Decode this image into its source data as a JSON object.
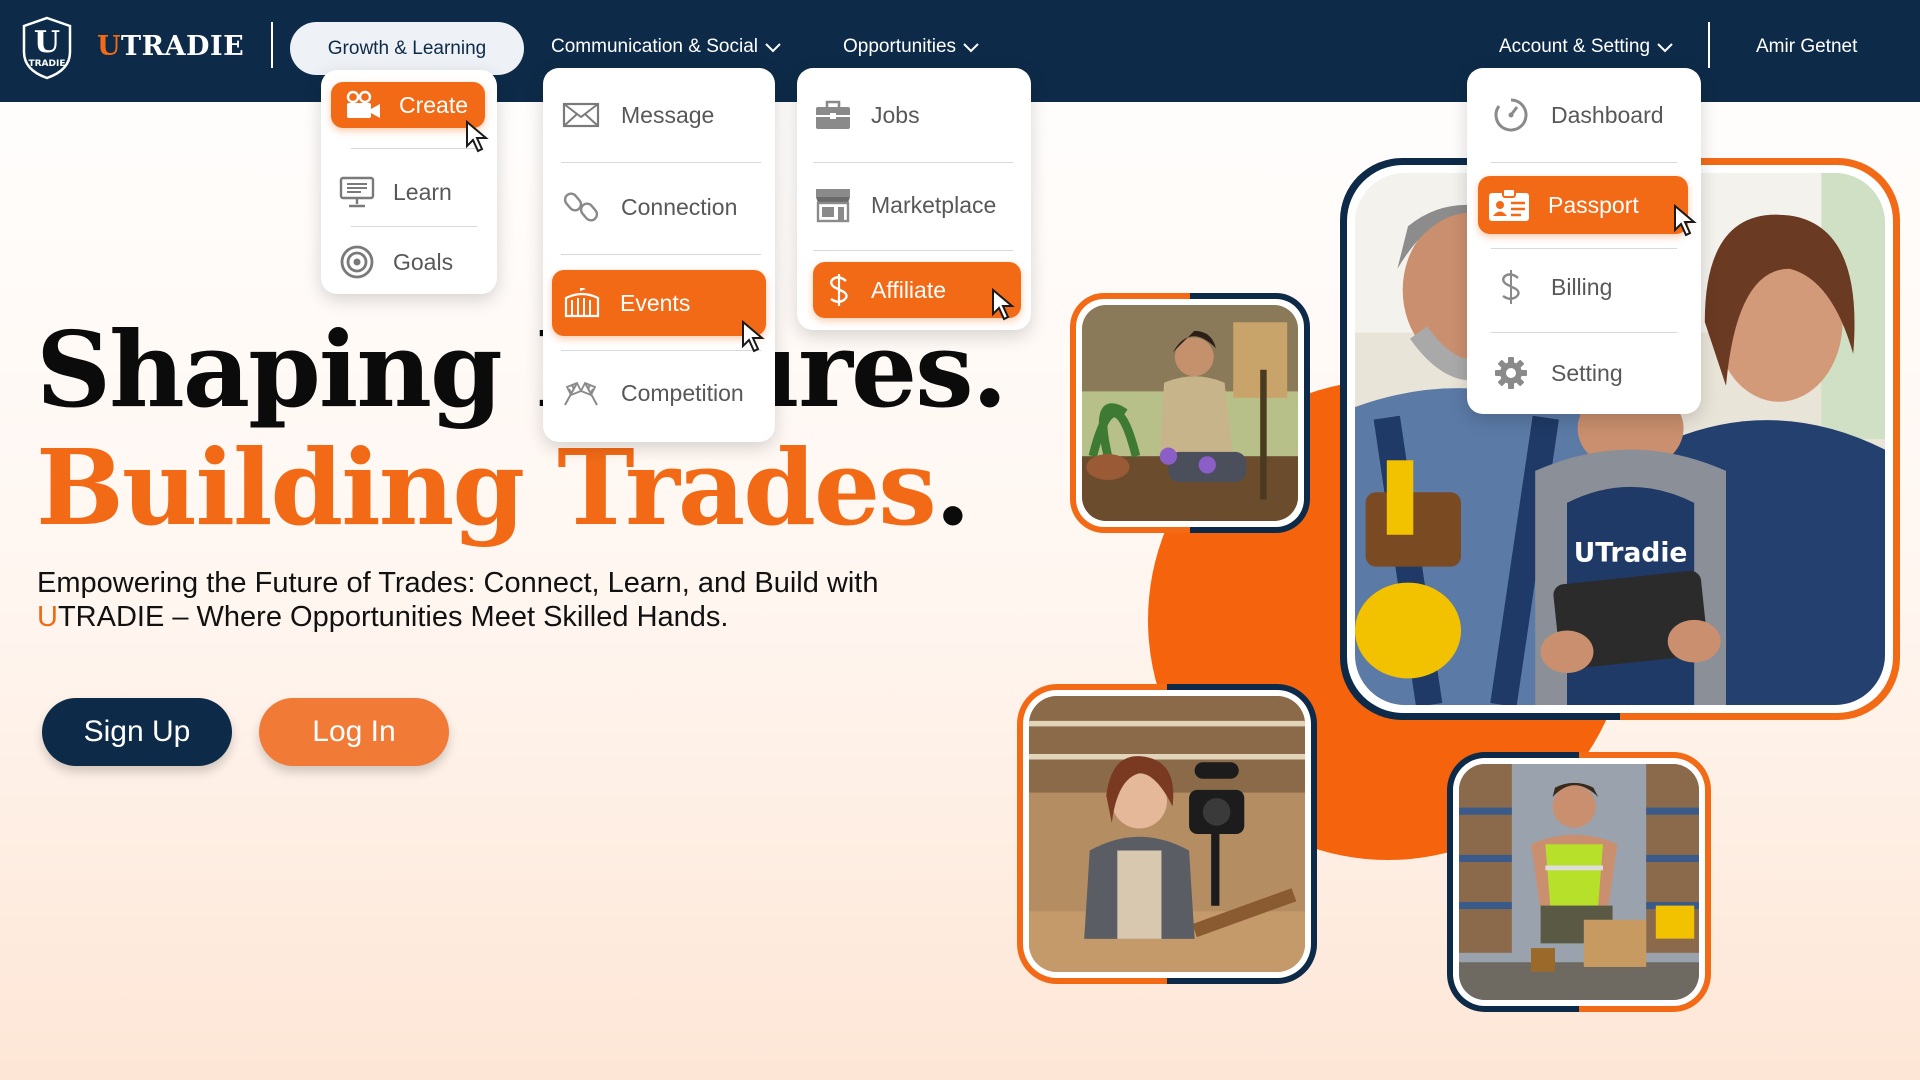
{
  "brand": {
    "prefix": "U",
    "rest": "TRADIE",
    "logo_letter": "U",
    "logo_caption": "TRADIE"
  },
  "nav": {
    "growth": "Growth & Learning",
    "communication": "Communication & Social",
    "opportunities": "Opportunities",
    "account": "Account & Setting",
    "user": "Amir Getnet"
  },
  "menus": {
    "growth": [
      {
        "label": "Create",
        "icon": "camera-icon",
        "active": true
      },
      {
        "label": "Learn",
        "icon": "monitor-icon",
        "active": false
      },
      {
        "label": "Goals",
        "icon": "target-icon",
        "active": false
      }
    ],
    "communication": [
      {
        "label": "Message",
        "icon": "envelope-icon",
        "active": false
      },
      {
        "label": "Connection",
        "icon": "link-icon",
        "active": false
      },
      {
        "label": "Events",
        "icon": "stadium-icon",
        "active": true
      },
      {
        "label": "Competition",
        "icon": "race-flags-icon",
        "active": false
      }
    ],
    "opportunities": [
      {
        "label": "Jobs",
        "icon": "briefcase-icon",
        "active": false
      },
      {
        "label": "Marketplace",
        "icon": "store-icon",
        "active": false
      },
      {
        "label": "Affiliate",
        "icon": "dollar-icon",
        "active": true
      }
    ],
    "account": [
      {
        "label": "Dashboard",
        "icon": "gauge-icon",
        "active": false
      },
      {
        "label": "Passport",
        "icon": "id-card-icon",
        "active": true
      },
      {
        "label": "Billing",
        "icon": "dollar-icon",
        "active": false
      },
      {
        "label": "Setting",
        "icon": "gear-icon",
        "active": false
      }
    ]
  },
  "hero": {
    "line1": "Shaping Futures.",
    "line2": "Building Trades",
    "line2_dot": ".",
    "tagline_a": "Empowering the Future of Trades: Connect, Learn, and Build with",
    "tagline_u": "U",
    "tagline_b": "TRADIE – Where Opportunities Meet Skilled Hands.",
    "signup": "Sign Up",
    "login": "Log In"
  },
  "photos": {
    "main_apron_text": "UTradie"
  },
  "colors": {
    "navy": "#0d2b48",
    "orange": "#f26a16",
    "white": "#ffffff"
  }
}
